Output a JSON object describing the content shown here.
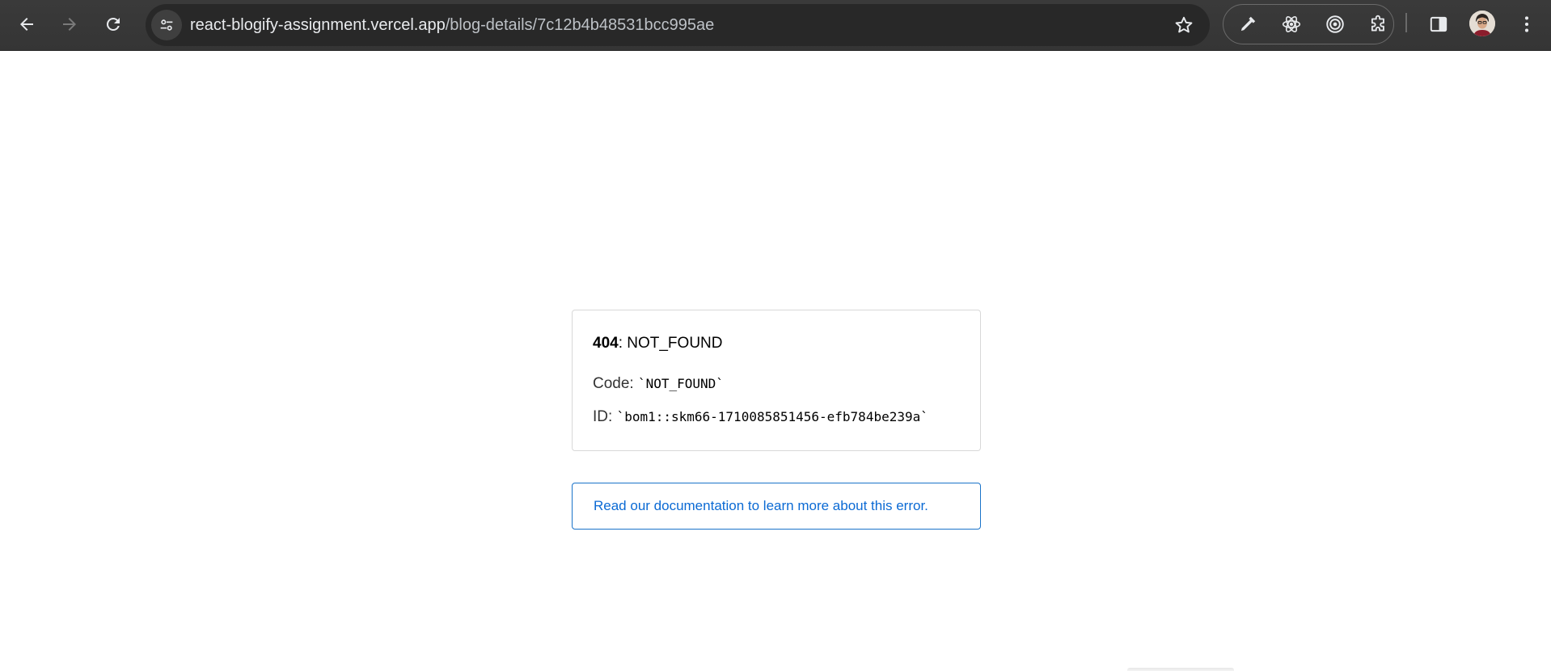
{
  "browser": {
    "url_host": "react-blogify-assignment.vercel.app",
    "url_path": "/blog-details/7c12b4b48531bcc995ae",
    "icons": {
      "back": "arrow-left-icon",
      "forward": "arrow-right-icon",
      "reload": "reload-icon",
      "site_info": "tune-icon",
      "bookmark": "star-icon",
      "ext1": "color-picker-icon",
      "ext2": "react-atom-icon",
      "ext3": "target-icon",
      "extensions": "puzzle-icon",
      "side_panel": "side-panel-icon",
      "menu": "kebab-menu-icon"
    }
  },
  "error": {
    "status_code": "404",
    "status_text": ": NOT_FOUND",
    "code_label": "Code: ",
    "code_value": "`NOT_FOUND`",
    "id_label": "ID: ",
    "id_value": "`bom1::skm66-1710085851456-efb784be239a`",
    "doc_link_text": "Read our documentation to learn more about this error."
  },
  "colors": {
    "toolbar_bg": "#353535",
    "omnibox_bg": "#282828",
    "link": "#0b6ad4",
    "card_border": "#d8d8d8"
  }
}
